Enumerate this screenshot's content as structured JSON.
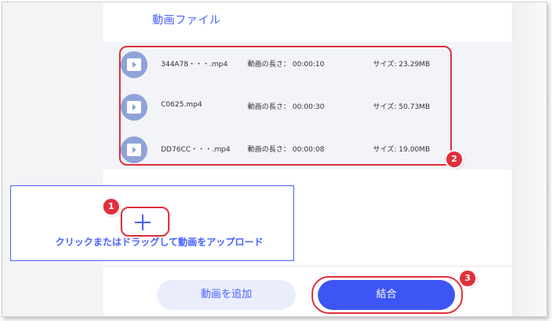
{
  "panel": {
    "title": "動画ファイル"
  },
  "files": [
    {
      "name": "344A78・・・.mp4",
      "duration_label": "動画の長さ：",
      "duration": "00:00:10",
      "size_label": "サイズ:",
      "size": "23.29MB"
    },
    {
      "name": "C0625.mp4",
      "duration_label": "動画の長さ：",
      "duration": "00:00:30",
      "size_label": "サイズ:",
      "size": "50.73MB"
    },
    {
      "name": "DD76CC・・・.mp4",
      "duration_label": "動画の長さ：",
      "duration": "00:00:08",
      "size_label": "サイズ:",
      "size": "19.00MB"
    }
  ],
  "upload": {
    "text": "クリックまたはドラッグして動画をアップロード"
  },
  "buttons": {
    "add_video": "動画を追加",
    "merge": "結合"
  },
  "annotations": {
    "badge1": "1",
    "badge2": "2",
    "badge3": "3"
  },
  "colors": {
    "accent": "#4a62ff",
    "highlight": "#e0303c",
    "play_icon": "#8fa3d9"
  },
  "icons": {
    "play": "play-icon",
    "plus": "plus-icon"
  }
}
